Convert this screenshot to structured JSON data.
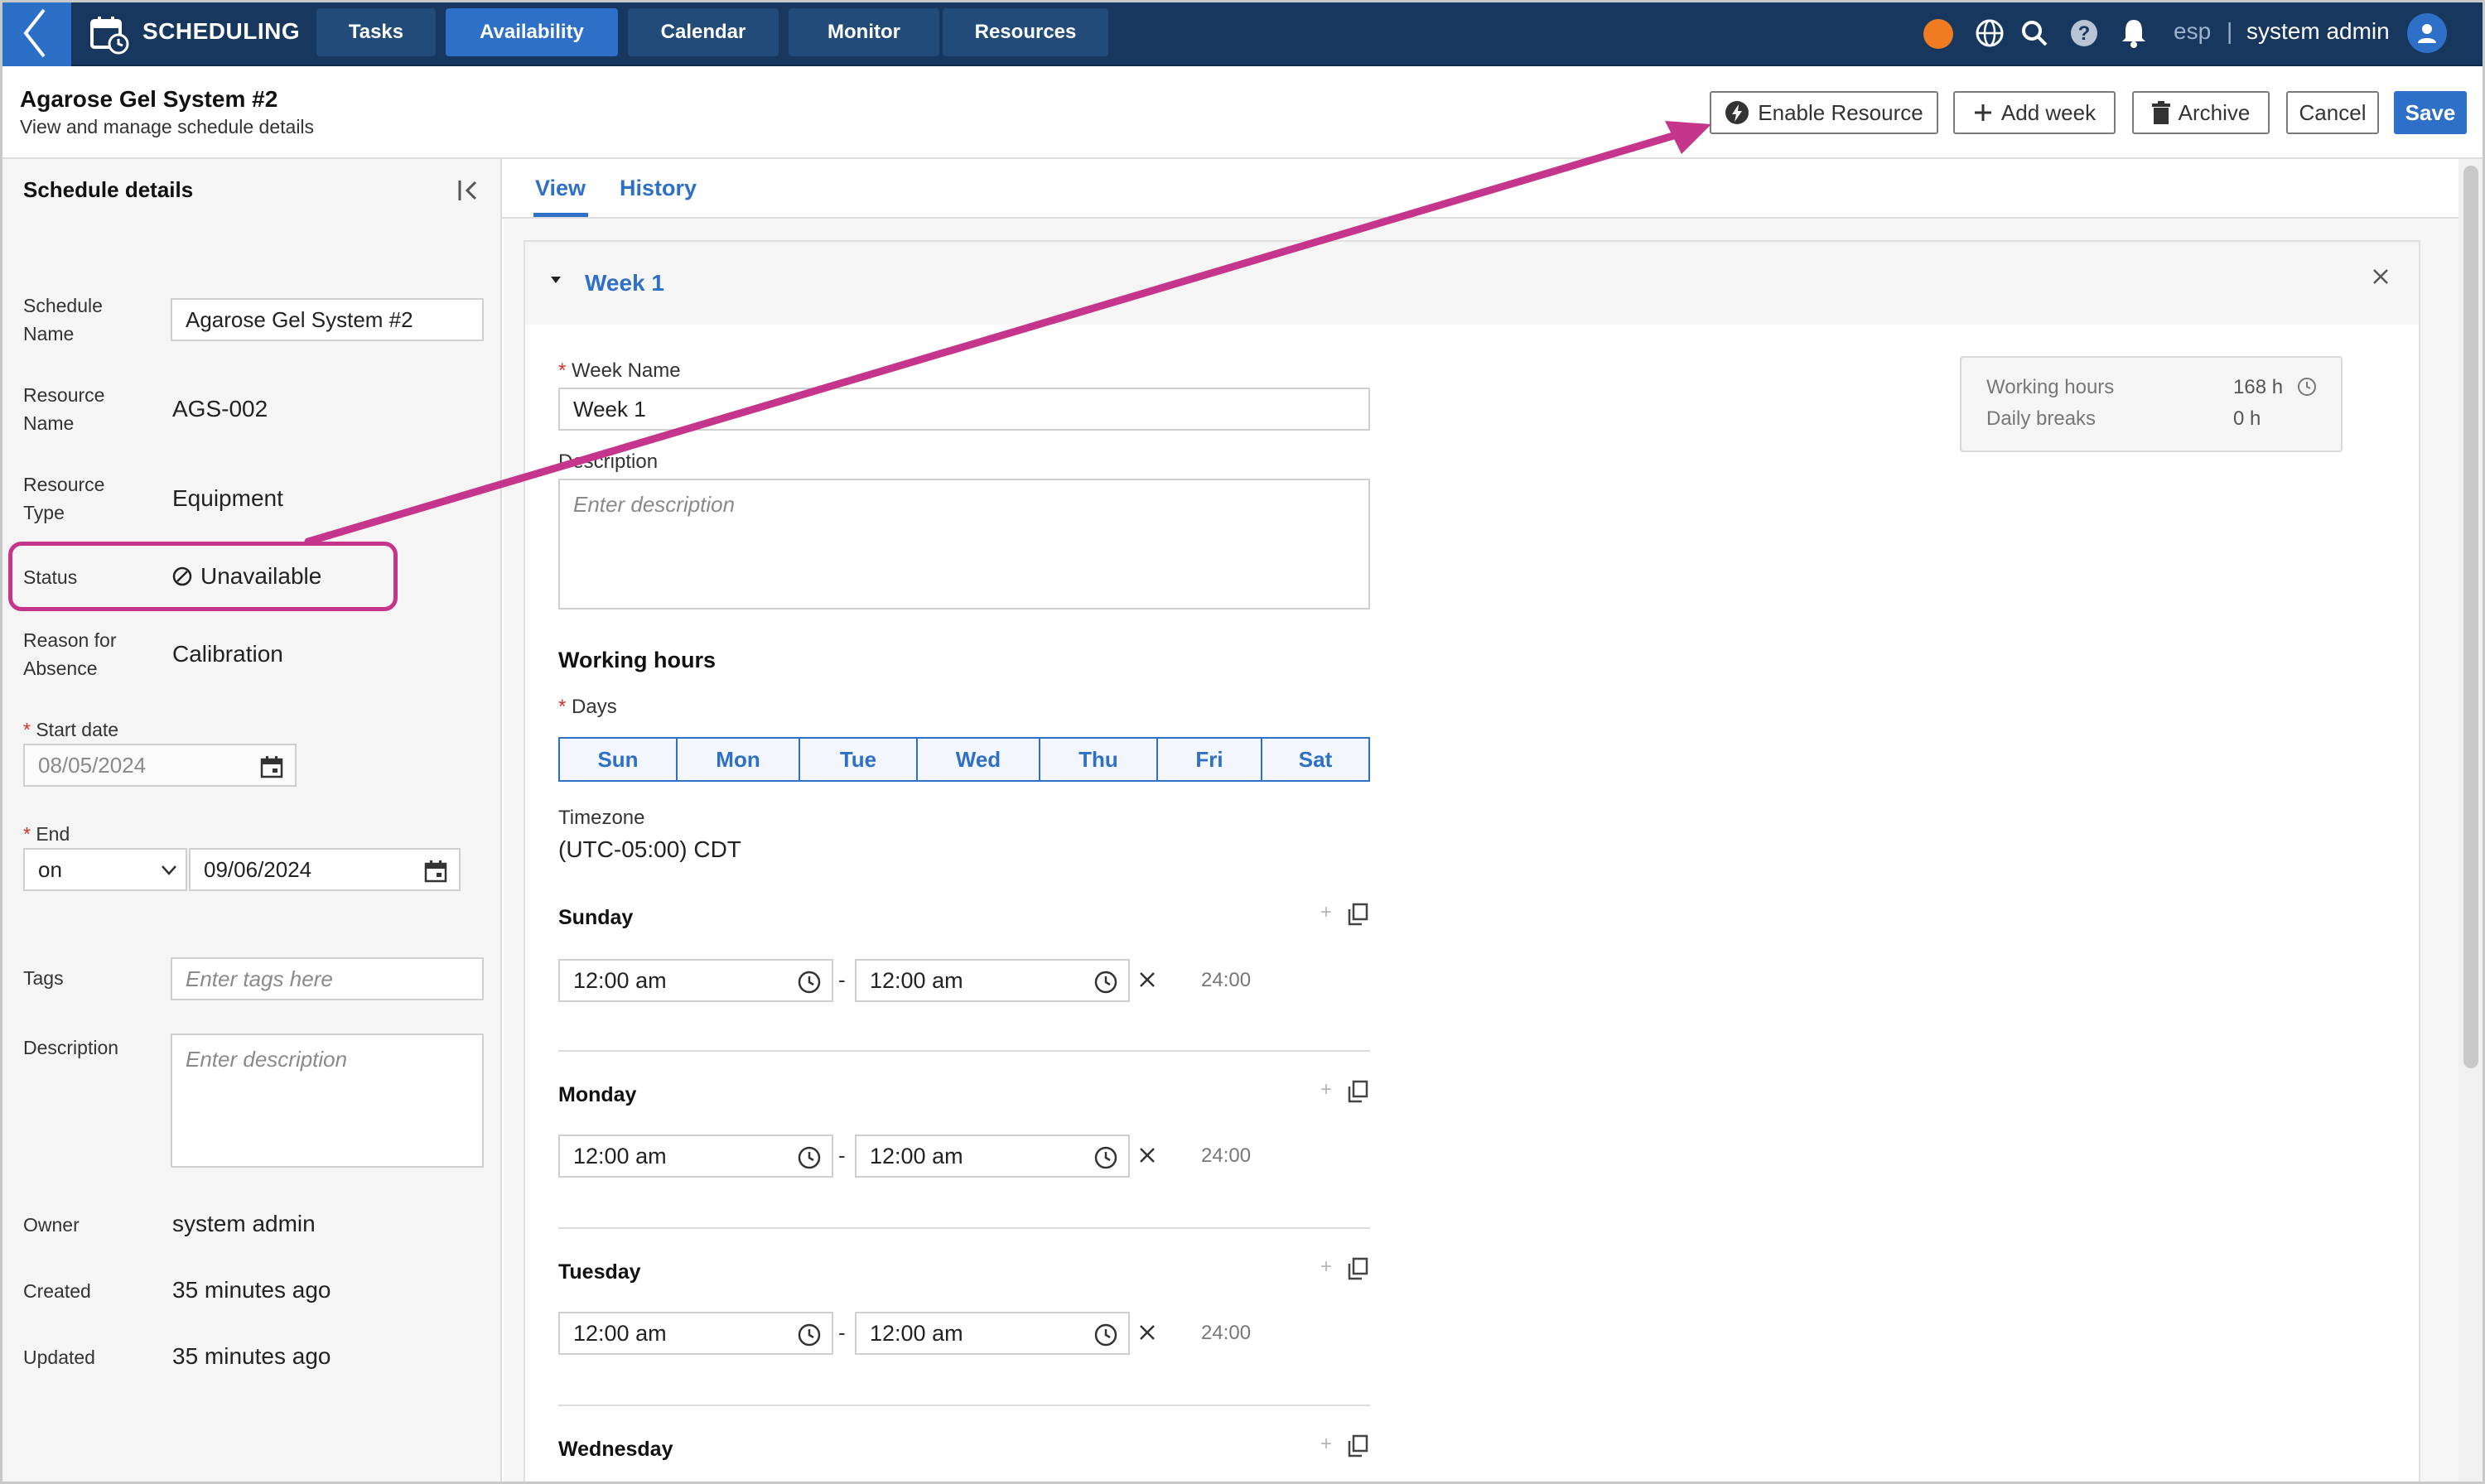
{
  "app": {
    "title": "SCHEDULING",
    "nav_tabs": [
      {
        "label": "Tasks",
        "active": false
      },
      {
        "label": "Availability",
        "active": true
      },
      {
        "label": "Calendar",
        "active": false
      },
      {
        "label": "Monitor",
        "active": false
      },
      {
        "label": "Resources",
        "active": false
      }
    ],
    "language": "esp",
    "separator": "|",
    "user": "system admin",
    "status_color": "#f07c22",
    "accent_color": "#2e6fc7",
    "nav_color": "#17375e",
    "annotation_color": "#c5358b"
  },
  "header": {
    "title": "Agarose Gel System #2",
    "subtitle": "View and manage schedule details",
    "buttons": {
      "enable_resource": "Enable Resource",
      "add_week": "Add week",
      "archive": "Archive",
      "cancel": "Cancel",
      "save": "Save"
    }
  },
  "details": {
    "title": "Schedule details",
    "schedule_name_label_1": "Schedule",
    "schedule_name_label_2": "Name",
    "schedule_name_value": "Agarose Gel System #2",
    "resource_name_label_1": "Resource",
    "resource_name_label_2": "Name",
    "resource_name_value": "AGS-002",
    "resource_type_label_1": "Resource",
    "resource_type_label_2": "Type",
    "resource_type_value": "Equipment",
    "status_label": "Status",
    "status_value": "Unavailable",
    "reason_label_1": "Reason for",
    "reason_label_2": "Absence",
    "reason_value": "Calibration",
    "required_mark": "*",
    "start_date_label": "Start date",
    "start_date_value": "08/05/2024",
    "end_label": "End",
    "end_mode": "on",
    "end_date_value": "09/06/2024",
    "tags_label": "Tags",
    "tags_placeholder": "Enter tags here",
    "description_label": "Description",
    "description_placeholder": "Enter description",
    "owner_label": "Owner",
    "owner_value": "system admin",
    "created_label": "Created",
    "created_value": "35 minutes ago",
    "updated_label": "Updated",
    "updated_value": "35 minutes ago"
  },
  "tabs": {
    "view": "View",
    "history": "History"
  },
  "week": {
    "title": "Week 1",
    "week_name_label": "Week Name",
    "week_name_value": "Week 1",
    "description_label": "Description",
    "description_placeholder": "Enter description",
    "working_hours_title": "Working hours",
    "days_label": "Days",
    "days": [
      "Sun",
      "Mon",
      "Tue",
      "Wed",
      "Thu",
      "Fri",
      "Sat"
    ],
    "timezone_label": "Timezone",
    "timezone_value": "(UTC-05:00) CDT",
    "dash": "-",
    "schedule": [
      {
        "day": "Sunday",
        "start": "12:00 am",
        "end": "12:00 am",
        "duration": "24:00"
      },
      {
        "day": "Monday",
        "start": "12:00 am",
        "end": "12:00 am",
        "duration": "24:00"
      },
      {
        "day": "Tuesday",
        "start": "12:00 am",
        "end": "12:00 am",
        "duration": "24:00"
      },
      {
        "day": "Wednesday"
      }
    ],
    "plus": "+",
    "summary": {
      "working_hours_label": "Working hours",
      "working_hours_value": "168 h",
      "daily_breaks_label": "Daily breaks",
      "daily_breaks_value": "0 h"
    }
  }
}
